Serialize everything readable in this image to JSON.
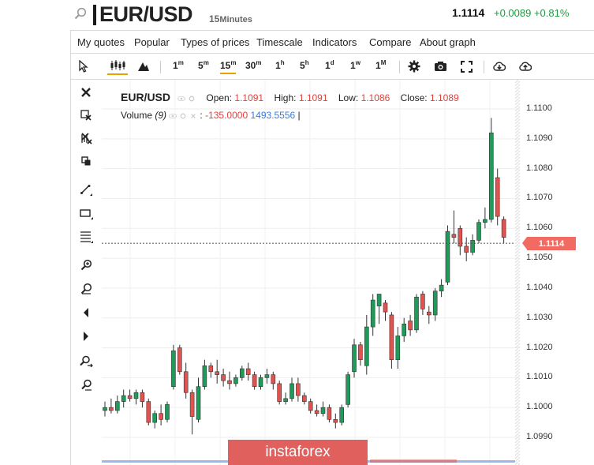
{
  "header": {
    "symbol": "EUR/USD",
    "timeframe_num": "15",
    "timeframe_unit": "Minutes",
    "last_price": "1.1114",
    "change": "+0.0089 +0.81%"
  },
  "menu": {
    "items": [
      "My quotes",
      "Popular",
      "Types of prices",
      "Timescale",
      "Indicators",
      "Compare",
      "About graph"
    ]
  },
  "toolbar": {
    "timeframes": [
      {
        "label": "1",
        "unit": "m"
      },
      {
        "label": "5",
        "unit": "m"
      },
      {
        "label": "15",
        "unit": "m"
      },
      {
        "label": "30",
        "unit": "m"
      },
      {
        "label": "1",
        "unit": "h"
      },
      {
        "label": "5",
        "unit": "h"
      },
      {
        "label": "1",
        "unit": "d"
      },
      {
        "label": "1",
        "unit": "w"
      },
      {
        "label": "1",
        "unit": "M"
      }
    ],
    "active_timeframe": "15m",
    "icons": [
      "cursor-icon",
      "candlestick-icon",
      "area-chart-icon",
      "gear-icon",
      "camera-icon",
      "fullscreen-icon",
      "download-icon",
      "upload-icon"
    ]
  },
  "left_tools": {
    "icons": [
      "close-icon",
      "remove-drawing-icon",
      "remove-all-icon",
      "clone-icon",
      "trendline-icon",
      "rectangle-icon",
      "fibonacci-icon",
      "zoom-in-icon",
      "zoom-out-icon",
      "scroll-left-icon",
      "scroll-right-icon",
      "zoom-in-right-icon",
      "zoom-reset-icon"
    ]
  },
  "legend": {
    "symbol": "EUR/USD",
    "open_label": "Open:",
    "open": "1.1091",
    "high_label": "High:",
    "high": "1.1091",
    "low_label": "Low:",
    "low": "1.1086",
    "close_label": "Close:",
    "close": "1.1089",
    "volume_label": "Volume",
    "volume_param": "(9)",
    "volume_value_1": "-135.0000",
    "volume_value_2": "1493.5556",
    "volume_sep": "|"
  },
  "price_tag": "1.1114",
  "watermark": "instaforex",
  "colors": {
    "up": "#1f9a5a",
    "down": "#e2534f",
    "accent": "#e8a200",
    "price_tag": "#f26b63"
  },
  "chart_data": {
    "type": "candlestick",
    "ylim": [
      1.0985,
      1.1108
    ],
    "y_ticks": [
      "1.1100",
      "1.1090",
      "1.1080",
      "1.1070",
      "1.1060",
      "1.1050",
      "1.1040",
      "1.1030",
      "1.1020",
      "1.1010",
      "1.1000",
      "1.0990"
    ],
    "current_price_line": 1.1055,
    "candles": [
      {
        "o": 1.0999,
        "h": 1.1002,
        "l": 1.0997,
        "c": 1.1
      },
      {
        "o": 1.1,
        "h": 1.1003,
        "l": 1.0998,
        "c": 1.0999
      },
      {
        "o": 1.0999,
        "h": 1.1004,
        "l": 1.0998,
        "c": 1.1002
      },
      {
        "o": 1.1002,
        "h": 1.1006,
        "l": 1.1,
        "c": 1.1004
      },
      {
        "o": 1.1004,
        "h": 1.1006,
        "l": 1.1002,
        "c": 1.1003
      },
      {
        "o": 1.1003,
        "h": 1.1006,
        "l": 1.1001,
        "c": 1.1005
      },
      {
        "o": 1.1005,
        "h": 1.1006,
        "l": 1.1,
        "c": 1.1002
      },
      {
        "o": 1.1002,
        "h": 1.1003,
        "l": 1.0994,
        "c": 1.0995
      },
      {
        "o": 1.0995,
        "h": 1.0999,
        "l": 1.0993,
        "c": 1.0998
      },
      {
        "o": 1.0998,
        "h": 1.1001,
        "l": 1.0994,
        "c": 1.0996
      },
      {
        "o": 1.0996,
        "h": 1.1002,
        "l": 1.0995,
        "c": 1.1001
      },
      {
        "o": 1.1007,
        "h": 1.1021,
        "l": 1.1006,
        "c": 1.1019
      },
      {
        "o": 1.102,
        "h": 1.1021,
        "l": 1.1011,
        "c": 1.1012
      },
      {
        "o": 1.1012,
        "h": 1.1015,
        "l": 1.1003,
        "c": 1.1005
      },
      {
        "o": 1.1005,
        "h": 1.1006,
        "l": 1.0991,
        "c": 1.0997
      },
      {
        "o": 1.0996,
        "h": 1.101,
        "l": 1.0995,
        "c": 1.1007
      },
      {
        "o": 1.1007,
        "h": 1.1016,
        "l": 1.1006,
        "c": 1.1014
      },
      {
        "o": 1.1014,
        "h": 1.1015,
        "l": 1.101,
        "c": 1.1012
      },
      {
        "o": 1.1012,
        "h": 1.1016,
        "l": 1.1008,
        "c": 1.1011
      },
      {
        "o": 1.1011,
        "h": 1.1013,
        "l": 1.1007,
        "c": 1.1009
      },
      {
        "o": 1.1009,
        "h": 1.1012,
        "l": 1.1006,
        "c": 1.1008
      },
      {
        "o": 1.1008,
        "h": 1.1011,
        "l": 1.1007,
        "c": 1.101
      },
      {
        "o": 1.101,
        "h": 1.1014,
        "l": 1.1009,
        "c": 1.1013
      },
      {
        "o": 1.1013,
        "h": 1.1015,
        "l": 1.1009,
        "c": 1.1011
      },
      {
        "o": 1.1011,
        "h": 1.1012,
        "l": 1.1006,
        "c": 1.1007
      },
      {
        "o": 1.1007,
        "h": 1.1011,
        "l": 1.1006,
        "c": 1.101
      },
      {
        "o": 1.101,
        "h": 1.1013,
        "l": 1.1008,
        "c": 1.1011
      },
      {
        "o": 1.1011,
        "h": 1.1012,
        "l": 1.1006,
        "c": 1.1008
      },
      {
        "o": 1.1008,
        "h": 1.1009,
        "l": 1.1001,
        "c": 1.1002
      },
      {
        "o": 1.1002,
        "h": 1.1005,
        "l": 1.1001,
        "c": 1.1003
      },
      {
        "o": 1.1003,
        "h": 1.101,
        "l": 1.1002,
        "c": 1.1008
      },
      {
        "o": 1.1008,
        "h": 1.101,
        "l": 1.1002,
        "c": 1.1004
      },
      {
        "o": 1.1004,
        "h": 1.1005,
        "l": 1.1001,
        "c": 1.1002
      },
      {
        "o": 1.1002,
        "h": 1.1003,
        "l": 1.0998,
        "c": 1.0999
      },
      {
        "o": 1.0999,
        "h": 1.1001,
        "l": 1.0997,
        "c": 1.0998
      },
      {
        "o": 1.0998,
        "h": 1.1002,
        "l": 1.0997,
        "c": 1.1
      },
      {
        "o": 1.1,
        "h": 1.1001,
        "l": 1.0995,
        "c": 1.0996
      },
      {
        "o": 1.0996,
        "h": 1.0998,
        "l": 1.0993,
        "c": 1.0995
      },
      {
        "o": 1.0995,
        "h": 1.1001,
        "l": 1.0994,
        "c": 1.1
      },
      {
        "o": 1.1001,
        "h": 1.1012,
        "l": 1.1,
        "c": 1.1011
      },
      {
        "o": 1.1012,
        "h": 1.1023,
        "l": 1.101,
        "c": 1.1021
      },
      {
        "o": 1.1021,
        "h": 1.1022,
        "l": 1.1014,
        "c": 1.1016
      },
      {
        "o": 1.1014,
        "h": 1.1031,
        "l": 1.1011,
        "c": 1.1027
      },
      {
        "o": 1.1027,
        "h": 1.1038,
        "l": 1.1024,
        "c": 1.1036
      },
      {
        "o": 1.1034,
        "h": 1.1038,
        "l": 1.1028,
        "c": 1.1038
      },
      {
        "o": 1.1035,
        "h": 1.1036,
        "l": 1.1029,
        "c": 1.1032
      },
      {
        "o": 1.1031,
        "h": 1.1032,
        "l": 1.1013,
        "c": 1.1016
      },
      {
        "o": 1.1016,
        "h": 1.1027,
        "l": 1.1013,
        "c": 1.1024
      },
      {
        "o": 1.1024,
        "h": 1.103,
        "l": 1.1022,
        "c": 1.1028
      },
      {
        "o": 1.1029,
        "h": 1.1031,
        "l": 1.1024,
        "c": 1.1026
      },
      {
        "o": 1.1026,
        "h": 1.1038,
        "l": 1.1025,
        "c": 1.1037
      },
      {
        "o": 1.1038,
        "h": 1.1039,
        "l": 1.1031,
        "c": 1.1033
      },
      {
        "o": 1.1032,
        "h": 1.1034,
        "l": 1.1028,
        "c": 1.1031
      },
      {
        "o": 1.1031,
        "h": 1.104,
        "l": 1.1029,
        "c": 1.1039
      },
      {
        "o": 1.1039,
        "h": 1.1043,
        "l": 1.1037,
        "c": 1.1041
      },
      {
        "o": 1.1042,
        "h": 1.1061,
        "l": 1.1041,
        "c": 1.1059
      },
      {
        "o": 1.1058,
        "h": 1.1066,
        "l": 1.1055,
        "c": 1.1057
      },
      {
        "o": 1.106,
        "h": 1.1061,
        "l": 1.1051,
        "c": 1.1054
      },
      {
        "o": 1.1054,
        "h": 1.1057,
        "l": 1.1049,
        "c": 1.1052
      },
      {
        "o": 1.1052,
        "h": 1.1058,
        "l": 1.1051,
        "c": 1.1056
      },
      {
        "o": 1.1056,
        "h": 1.1063,
        "l": 1.1055,
        "c": 1.1062
      },
      {
        "o": 1.1062,
        "h": 1.1067,
        "l": 1.106,
        "c": 1.1063
      },
      {
        "o": 1.1063,
        "h": 1.1097,
        "l": 1.1062,
        "c": 1.1092
      },
      {
        "o": 1.1077,
        "h": 1.108,
        "l": 1.1061,
        "c": 1.1064
      },
      {
        "o": 1.1063,
        "h": 1.1064,
        "l": 1.1055,
        "c": 1.1057
      }
    ]
  }
}
